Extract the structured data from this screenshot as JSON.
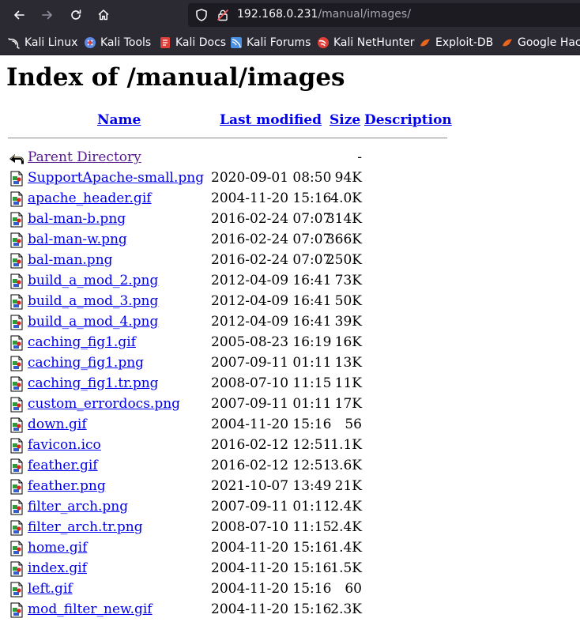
{
  "browser": {
    "url_host": "192.168.0.231",
    "url_path": "/manual/images/",
    "bookmarks": [
      {
        "label": "Kali Linux",
        "icon": "kali-dragon-icon",
        "color": "#ffffff"
      },
      {
        "label": "Kali Tools",
        "icon": "kali-tools-icon",
        "color": "#5c88e6"
      },
      {
        "label": "Kali Docs",
        "icon": "kali-docs-icon",
        "color": "#e0403a"
      },
      {
        "label": "Kali Forums",
        "icon": "kali-forums-icon",
        "color": "#4a90e2"
      },
      {
        "label": "Kali NetHunter",
        "icon": "kali-nethunter-icon",
        "color": "#e0403a"
      },
      {
        "label": "Exploit-DB",
        "icon": "exploit-db-icon",
        "color": "#e8661c"
      },
      {
        "label": "Google Hack",
        "icon": "google-hacking-icon",
        "color": "#e8661c"
      }
    ]
  },
  "page": {
    "title": "Index of /manual/images",
    "columns": {
      "name": "Name",
      "last_modified": "Last modified",
      "size": "Size",
      "description": "Description"
    },
    "parent": {
      "name": "Parent Directory",
      "size": "-",
      "icon": "back-arrow-icon"
    },
    "files": [
      {
        "name": "SupportApache-small.png",
        "date": "2020-09-01 08:50",
        "size": "94K"
      },
      {
        "name": "apache_header.gif",
        "date": "2004-11-20 15:16",
        "size": "4.0K"
      },
      {
        "name": "bal-man-b.png",
        "date": "2016-02-24 07:07",
        "size": "314K"
      },
      {
        "name": "bal-man-w.png",
        "date": "2016-02-24 07:07",
        "size": "366K"
      },
      {
        "name": "bal-man.png",
        "date": "2016-02-24 07:07",
        "size": "250K"
      },
      {
        "name": "build_a_mod_2.png",
        "date": "2012-04-09 16:41",
        "size": "73K"
      },
      {
        "name": "build_a_mod_3.png",
        "date": "2012-04-09 16:41",
        "size": "50K"
      },
      {
        "name": "build_a_mod_4.png",
        "date": "2012-04-09 16:41",
        "size": "39K"
      },
      {
        "name": "caching_fig1.gif",
        "date": "2005-08-23 16:19",
        "size": "16K"
      },
      {
        "name": "caching_fig1.png",
        "date": "2007-09-11 01:11",
        "size": "13K"
      },
      {
        "name": "caching_fig1.tr.png",
        "date": "2008-07-10 11:15",
        "size": "11K"
      },
      {
        "name": "custom_errordocs.png",
        "date": "2007-09-11 01:11",
        "size": "17K"
      },
      {
        "name": "down.gif",
        "date": "2004-11-20 15:16",
        "size": "56"
      },
      {
        "name": "favicon.ico",
        "date": "2016-02-12 12:51",
        "size": "1.1K"
      },
      {
        "name": "feather.gif",
        "date": "2016-02-12 12:51",
        "size": "3.6K"
      },
      {
        "name": "feather.png",
        "date": "2021-10-07 13:49",
        "size": "21K"
      },
      {
        "name": "filter_arch.png",
        "date": "2007-09-11 01:11",
        "size": "2.4K"
      },
      {
        "name": "filter_arch.tr.png",
        "date": "2008-07-10 11:15",
        "size": "2.4K"
      },
      {
        "name": "home.gif",
        "date": "2004-11-20 15:16",
        "size": "1.4K"
      },
      {
        "name": "index.gif",
        "date": "2004-11-20 15:16",
        "size": "1.5K"
      },
      {
        "name": "left.gif",
        "date": "2004-11-20 15:16",
        "size": "60"
      },
      {
        "name": "mod_filter_new.gif",
        "date": "2004-11-20 15:16",
        "size": "2.3K"
      }
    ],
    "file_icon": "image-file-icon",
    "link_color": "#0000ee",
    "visited_color": "#551a8b"
  }
}
